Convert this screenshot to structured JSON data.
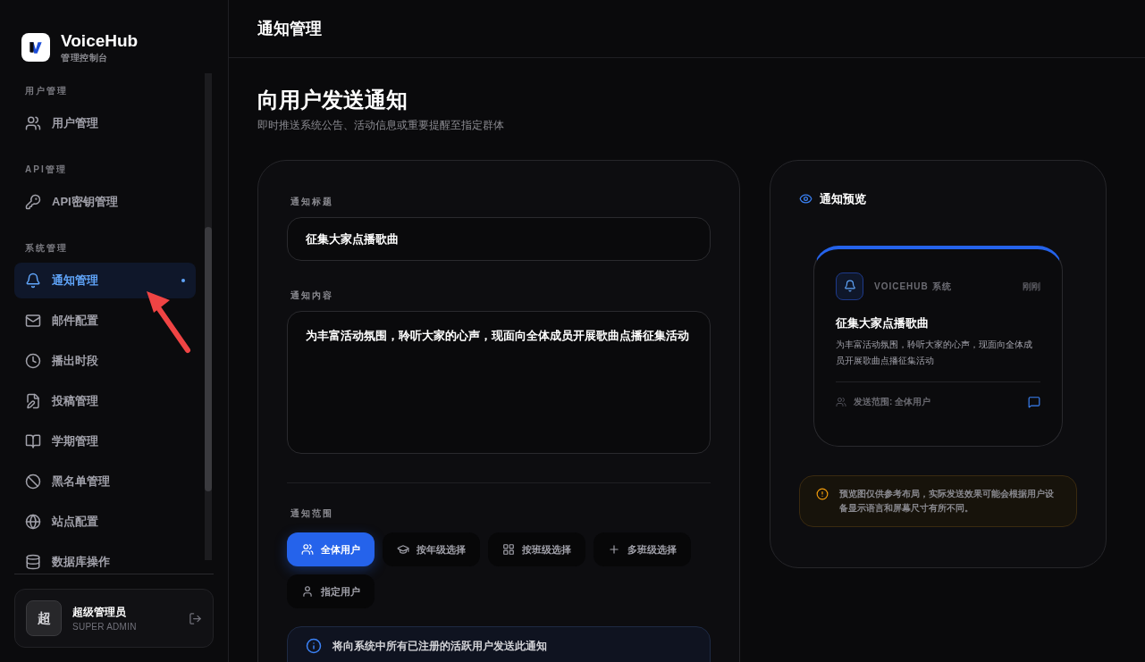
{
  "brand": {
    "name": "VoiceHub",
    "subtitle": "管理控制台"
  },
  "nav": [
    {
      "section": "用户管理",
      "items": [
        {
          "label": "用户管理",
          "selected": false
        }
      ]
    },
    {
      "section": "API管理",
      "items": [
        {
          "label": "API密钥管理",
          "selected": false
        }
      ]
    },
    {
      "section": "系统管理",
      "items": [
        {
          "label": "通知管理",
          "selected": true
        },
        {
          "label": "邮件配置",
          "selected": false
        },
        {
          "label": "播出时段",
          "selected": false
        },
        {
          "label": "投稿管理",
          "selected": false
        },
        {
          "label": "学期管理",
          "selected": false
        },
        {
          "label": "黑名单管理",
          "selected": false
        },
        {
          "label": "站点配置",
          "selected": false
        },
        {
          "label": "数据库操作",
          "selected": false
        }
      ]
    }
  ],
  "user": {
    "avatar": "超",
    "name": "超级管理员",
    "role": "SUPER ADMIN"
  },
  "header": {
    "title": "通知管理"
  },
  "page": {
    "title": "向用户发送通知",
    "subtitle": "即时推送系统公告、活动信息或重要提醒至指定群体"
  },
  "form": {
    "title_label": "通知标题",
    "title_value": "征集大家点播歌曲",
    "content_label": "通知内容",
    "content_value": "为丰富活动氛围，聆听大家的心声，现面向全体成员开展歌曲点播征集活动",
    "scope_label": "通知范围",
    "scopes": [
      {
        "label": "全体用户",
        "selected": true
      },
      {
        "label": "按年级选择",
        "selected": false
      },
      {
        "label": "按班级选择",
        "selected": false
      },
      {
        "label": "多班级选择",
        "selected": false
      },
      {
        "label": "指定用户",
        "selected": false
      }
    ],
    "info": "将向系统中所有已注册的活跃用户发送此通知"
  },
  "preview": {
    "heading": "通知预览",
    "sender": "VOICEHUB 系统",
    "time": "刚刚",
    "title": "征集大家点播歌曲",
    "body": "为丰富活动氛围，聆听大家的心声，现面向全体成员开展歌曲点播征集活动",
    "scope": "发送范围: 全体用户",
    "note": "预览图仅供参考布局，实际发送效果可能会根据用户设备显示语言和屏幕尺寸有所不同。"
  }
}
